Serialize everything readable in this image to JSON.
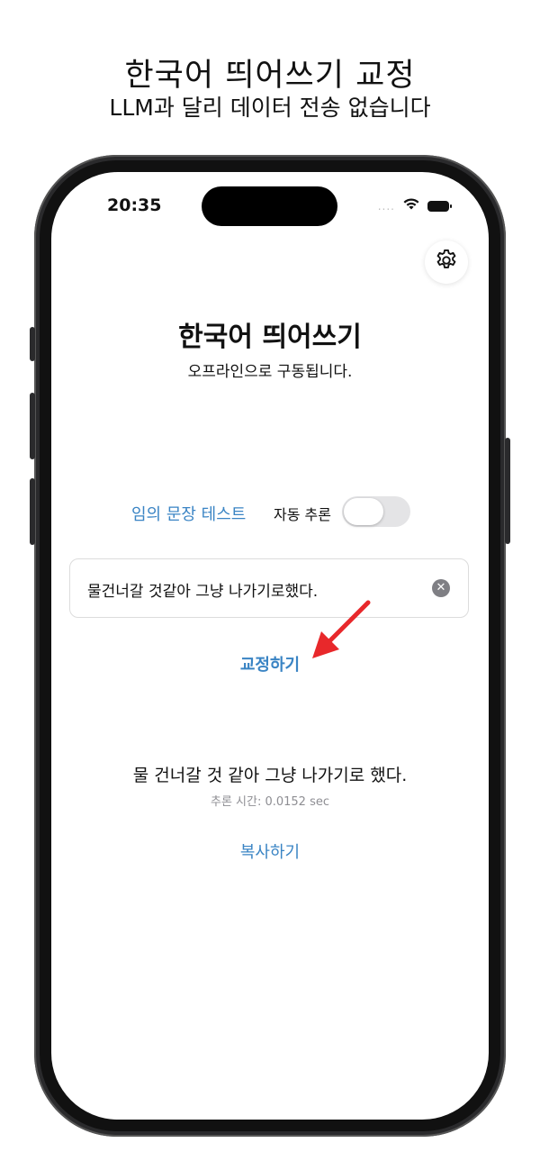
{
  "promo": {
    "title": "한국어 띄어쓰기 교정",
    "subtitle": "LLM과 달리 데이터 전송 없습니다"
  },
  "status_bar": {
    "time": "20:35",
    "signal": "....",
    "icons": [
      "wifi-icon",
      "battery-icon"
    ]
  },
  "header": {
    "settings_icon": "gear-icon"
  },
  "app": {
    "title": "한국어 띄어쓰기",
    "subtitle": "오프라인으로 구동됩니다."
  },
  "controls": {
    "random_test_label": "임의 문장 테스트",
    "auto_inference_label": "자동 추론",
    "auto_inference_on": false
  },
  "input": {
    "value": "물건너갈 것같아 그냥 나가기로했다."
  },
  "actions": {
    "correct_label": "교정하기",
    "copy_label": "복사하기"
  },
  "result": {
    "text": "물 건너갈 것 같아 그냥 나가기로 했다.",
    "inference_time": "추론 시간: 0.0152 sec"
  },
  "colors": {
    "accent": "#3a84c4",
    "arrow": "#e8282b",
    "toggle_off": "#e4e4e6"
  }
}
